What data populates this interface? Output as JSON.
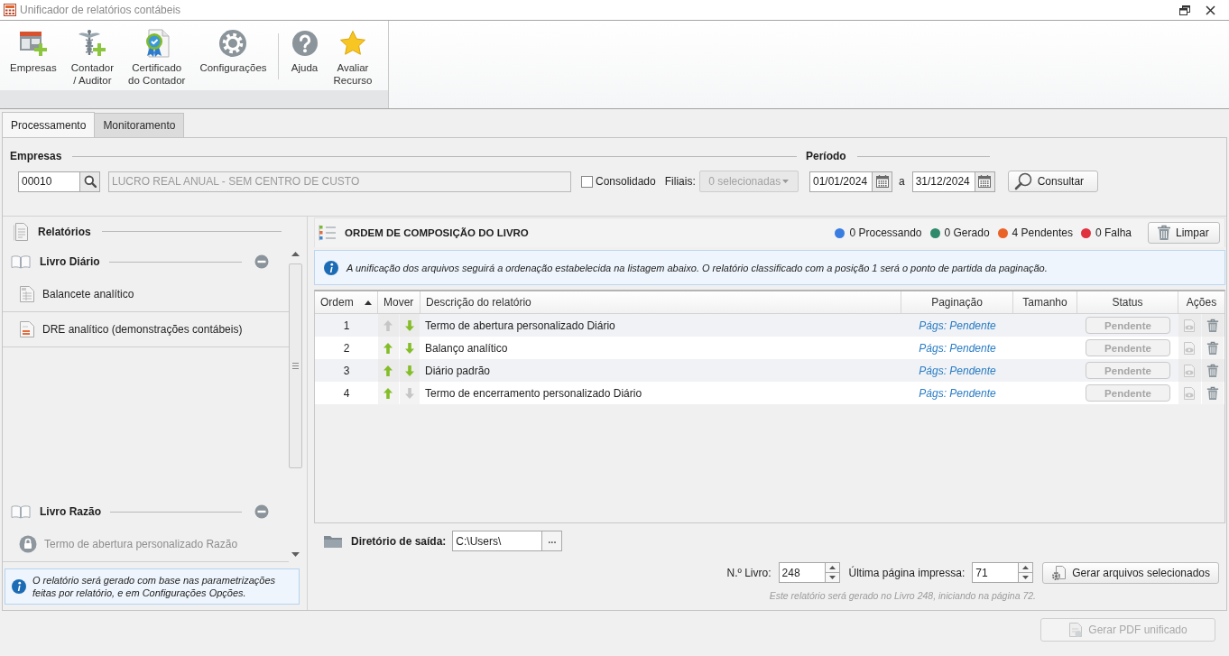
{
  "window": {
    "title": "Unificador de relatórios contábeis"
  },
  "toolbar": {
    "groups": [
      {
        "items": [
          {
            "lines": [
              "Empresas"
            ]
          },
          {
            "lines": [
              "Contador",
              "/ Auditor"
            ]
          },
          {
            "lines": [
              "Certificado",
              "do Contador"
            ]
          },
          {
            "lines": [
              "Configurações"
            ]
          }
        ]
      },
      {
        "items": [
          {
            "lines": [
              "Ajuda"
            ]
          },
          {
            "lines": [
              "Avaliar",
              "Recurso"
            ]
          }
        ]
      }
    ]
  },
  "tabs": [
    {
      "label": "Processamento",
      "selected": true
    },
    {
      "label": "Monitoramento",
      "selected": false
    }
  ],
  "company": {
    "title": "Empresas",
    "code": "00010",
    "name": {
      "value": "LUCRO REAL ANUAL - SEM CENTRO DE CUSTO",
      "disabled": true
    },
    "consolidated": {
      "label": "Consolidado",
      "checked": false
    },
    "branches": {
      "label": "Filiais:",
      "value": "0 selecionadas",
      "disabled": true
    }
  },
  "period": {
    "title": "Período",
    "start": "01/01/2024",
    "separator": "a",
    "end": "31/12/2024",
    "button": "Consultar"
  },
  "sidebar": {
    "title": "Relatórios",
    "groups": [
      {
        "title": "Livro Diário",
        "expanded": true,
        "items": [
          {
            "label": "Balancete analítico",
            "locked": false
          },
          {
            "label": "DRE analítico (demonstrações contábeis)",
            "locked": false
          }
        ]
      },
      {
        "title": "Livro Razão",
        "expanded": true,
        "items": [
          {
            "label": "Termo de abertura personalizado Razão",
            "locked": true
          }
        ]
      }
    ],
    "note": "O relatório será gerado com base nas parametrizações feitas por relatório, e em Configurações Opções."
  },
  "composition": {
    "title": "ORDEM DE COMPOSIÇÃO DO LIVRO",
    "legend": [
      {
        "label": "0 Processando",
        "color": "#3a7de0"
      },
      {
        "label": "0 Gerado",
        "color": "#2e8a6a"
      },
      {
        "label": "4 Pendentes",
        "color": "#ea6326"
      },
      {
        "label": "0 Falha",
        "color": "#e0313f"
      }
    ],
    "clear_button": "Limpar",
    "info": "A unificação dos arquivos seguirá a ordenação estabelecida na listagem abaixo. O relatório classificado com a posição 1 será o ponto de partida da paginação.",
    "table": {
      "columns": [
        {
          "label": "Ordem",
          "sorted": true
        },
        {
          "label": "Mover"
        },
        {
          "label": "Descrição do relatório"
        },
        {
          "label": "Paginação"
        },
        {
          "label": "Tamanho"
        },
        {
          "label": "Status"
        },
        {
          "label": "Ações"
        }
      ],
      "rows": [
        {
          "order": "1",
          "up_enabled": false,
          "down_enabled": true,
          "description": "Termo de abertura personalizado Diário",
          "pagination": "Págs: Pendente",
          "status": {
            "label": "Pendente",
            "disabled": true
          },
          "preview_disabled": true
        },
        {
          "order": "2",
          "up_enabled": true,
          "down_enabled": true,
          "description": "Balanço analítico",
          "pagination": "Págs: Pendente",
          "status": {
            "label": "Pendente",
            "disabled": true
          },
          "preview_disabled": true
        },
        {
          "order": "3",
          "up_enabled": true,
          "down_enabled": true,
          "description": "Diário padrão",
          "pagination": "Págs: Pendente",
          "status": {
            "label": "Pendente",
            "disabled": true
          },
          "preview_disabled": true
        },
        {
          "order": "4",
          "up_enabled": true,
          "down_enabled": false,
          "description": "Termo de encerramento personalizado Diário",
          "pagination": "Págs: Pendente",
          "status": {
            "label": "Pendente",
            "disabled": true
          },
          "preview_disabled": true
        }
      ]
    },
    "output": {
      "label": "Diretório de saída:",
      "value": "C:\\Users\\",
      "browse": "..."
    },
    "book": {
      "label": "N.º Livro:",
      "value": "248"
    },
    "last_page": {
      "label": "Última página impressa:",
      "value": "71"
    },
    "generate_button": "Gerar arquivos selecionados",
    "hint": "Este relatório será gerado no Livro 248, iniciando na página 72."
  },
  "footer": {
    "button": {
      "label": "Gerar PDF unificado",
      "disabled": true
    }
  }
}
